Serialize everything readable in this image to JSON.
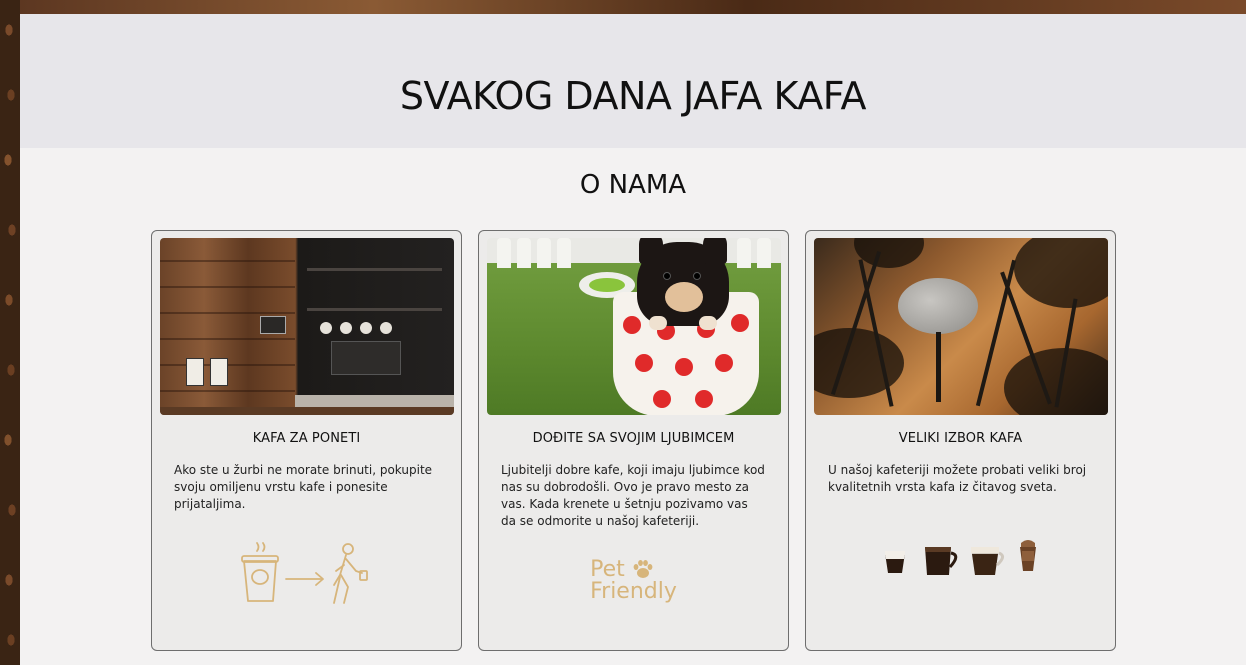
{
  "hero": {
    "title": "SVAKOG DANA JAFA KAFA"
  },
  "about": {
    "title": "O NAMA",
    "cards": [
      {
        "title": "KAFA ZA PONETI",
        "text": "Ako ste u žurbi ne morate brinuti, pokupite svoju omiljenu vrstu kafe i ponesite prijataljima.",
        "icon": "takeaway-walk-icon"
      },
      {
        "title": "DOĐITE SA SVOJIM LJUBIMCEM",
        "text": "Ljubitelji dobre kafe, koji imaju ljubimce kod nas su dobrodošli. Ovo je pravo mesto za vas. Kada krenete u šetnju pozivamo vas da se odmorite u našoj kafeteriji.",
        "icon": "pet-friendly-icon",
        "icon_text_1": "Pet",
        "icon_text_2": "Friendly"
      },
      {
        "title": "VELIKI IZBOR KAFA",
        "text": "U našoj kafeteriji možete probati veliki broj kvalitetnih vrsta kafa iz čitavog sveta.",
        "icon": "coffee-cups-icon"
      }
    ]
  },
  "colors": {
    "hero_bg": "#e7e6ea",
    "page_bg": "#f3f2f2",
    "card_bg": "#ecebea",
    "accent_gold": "#d7b57b"
  }
}
